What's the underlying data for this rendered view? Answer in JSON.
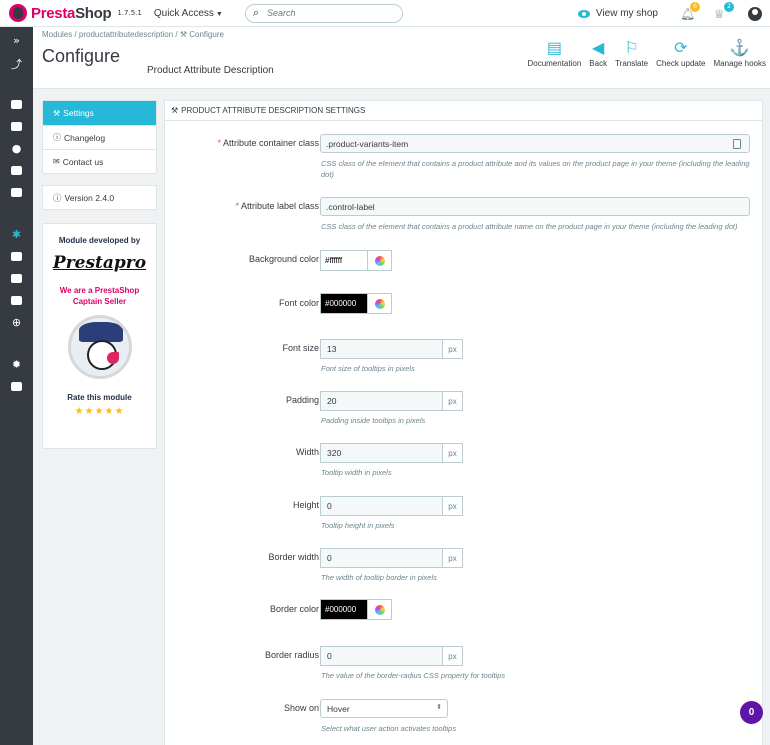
{
  "topbar": {
    "logo_text_1": "Presta",
    "logo_text_2": "Shop",
    "version": "1.7.5.1",
    "quick_access": "Quick Access",
    "search_placeholder": "Search",
    "view_shop": "View my shop",
    "notif_orders": "6",
    "notif_customers": "2"
  },
  "header": {
    "breadcrumb": "Modules  /  productattributedescription  /  ⚒ Configure",
    "title": "Configure",
    "subtitle": "Product Attribute Description",
    "toolbar": [
      "Documentation",
      "Back",
      "Translate",
      "Check update",
      "Manage hooks"
    ]
  },
  "left_menu": {
    "items": [
      "Settings",
      "Changelog",
      "Contact us"
    ],
    "version": "Version 2.4.0",
    "developed_by": "Module developed by",
    "brand": "Prestapro",
    "captain": "We are a PrestaShop Captain Seller",
    "rate": "Rate this module",
    "stars": "★★★★★"
  },
  "panel": {
    "heading": "PRODUCT ATTRIBUTE DESCRIPTION SETTINGS",
    "fields": {
      "container_class": {
        "label": "Attribute container class",
        "value": ".product-variants-item",
        "help": "CSS class of the element that contains a product attribute and its values on the product page in your theme (including the leading dot)"
      },
      "label_class": {
        "label": "Attribute label class",
        "value": ".control-label",
        "help": "CSS class of the element that contains a product attribute name on the product page in your theme (including the leading dot)"
      },
      "background_color": {
        "label": "Background color",
        "value": "#ffffff"
      },
      "font_color": {
        "label": "Font color",
        "value": "#000000"
      },
      "font_size": {
        "label": "Font size",
        "value": "13",
        "unit": "px",
        "help": "Font size of tooltips in pixels"
      },
      "padding": {
        "label": "Padding",
        "value": "20",
        "unit": "px",
        "help": "Padding inside tooltips in pixels"
      },
      "width": {
        "label": "Width",
        "value": "320",
        "unit": "px",
        "help": "Tooltip width in pixels"
      },
      "height": {
        "label": "Height",
        "value": "0",
        "unit": "px",
        "help": "Tooltip height in pixels"
      },
      "border_width": {
        "label": "Border width",
        "value": "0",
        "unit": "px",
        "help": "The width of tooltip border in pixels"
      },
      "border_color": {
        "label": "Border color",
        "value": "#000000"
      },
      "border_radius": {
        "label": "Border radius",
        "value": "0",
        "unit": "px",
        "help": "The value of the border-radius CSS property for tooltips"
      },
      "show_on": {
        "label": "Show on",
        "value": "Hover",
        "help": "Select what user action activates tooltips"
      }
    }
  },
  "help_fab": "0",
  "colors": {
    "accent": "#25b9d7",
    "brand": "#df0067",
    "sidebar": "#363a41"
  }
}
